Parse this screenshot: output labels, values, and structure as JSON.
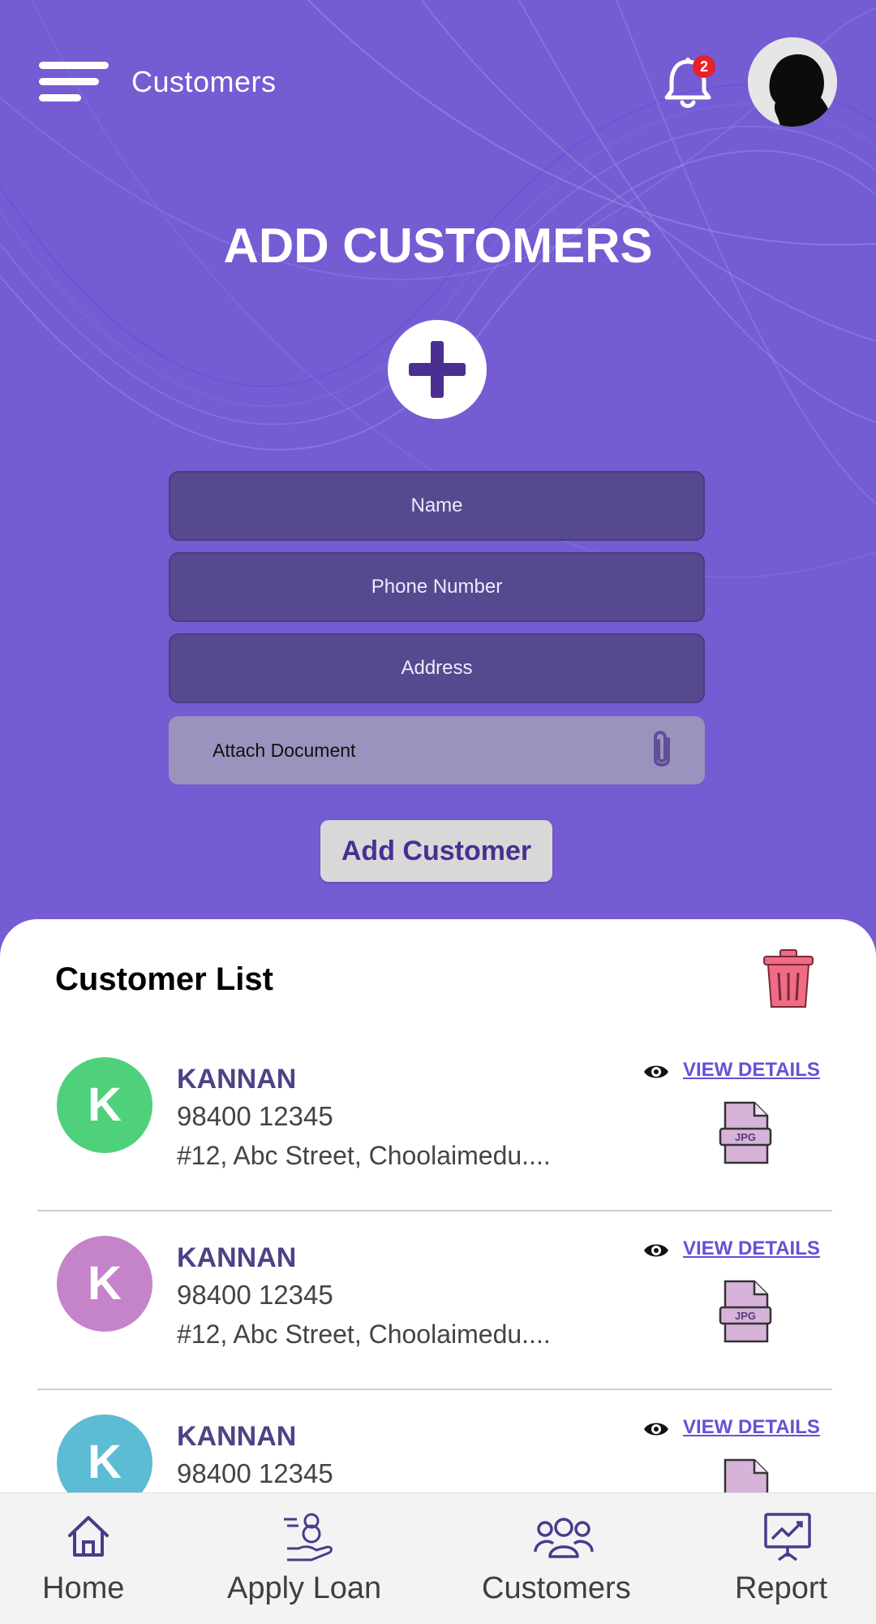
{
  "header": {
    "title": "Customers",
    "notification_count": "2",
    "menu_icon": "hamburger-menu-icon",
    "bell_icon": "bell-icon"
  },
  "form": {
    "title": "ADD CUSTOMERS",
    "add_icon": "plus-icon",
    "fields": {
      "name_placeholder": "Name",
      "phone_placeholder": "Phone Number",
      "address_placeholder": "Address"
    },
    "attach_label": "Attach Document",
    "attach_icon": "paperclip-icon",
    "submit_label": "Add Customer"
  },
  "customer_list": {
    "title": "Customer List",
    "delete_icon": "trash-icon",
    "view_label": "VIEW DETAILS",
    "items": [
      {
        "initial": "K",
        "name": "KANNAN",
        "phone": "98400 12345",
        "address": "#12, Abc Street, Choolaimedu....",
        "color": "#4fd07b",
        "file_type": "JPG"
      },
      {
        "initial": "K",
        "name": "KANNAN",
        "phone": "98400 12345",
        "address": "#12, Abc Street, Choolaimedu....",
        "color": "#c583c9",
        "file_type": "JPG"
      },
      {
        "initial": "K",
        "name": "KANNAN",
        "phone": "98400 12345",
        "address": "",
        "color": "#5bbcd4",
        "file_type": "JPG"
      }
    ]
  },
  "bottom_nav": {
    "items": [
      {
        "label": "Home",
        "icon": "home-icon"
      },
      {
        "label": "Apply Loan",
        "icon": "loan-hand-icon"
      },
      {
        "label": "Customers",
        "icon": "users-icon"
      },
      {
        "label": "Report",
        "icon": "report-chart-icon"
      }
    ]
  },
  "colors": {
    "background": "#755cd2",
    "field": "#57498f",
    "accent": "#4b2e91",
    "link": "#6a4fd4",
    "badge": "#e8202a",
    "trash": "#f06b86"
  }
}
